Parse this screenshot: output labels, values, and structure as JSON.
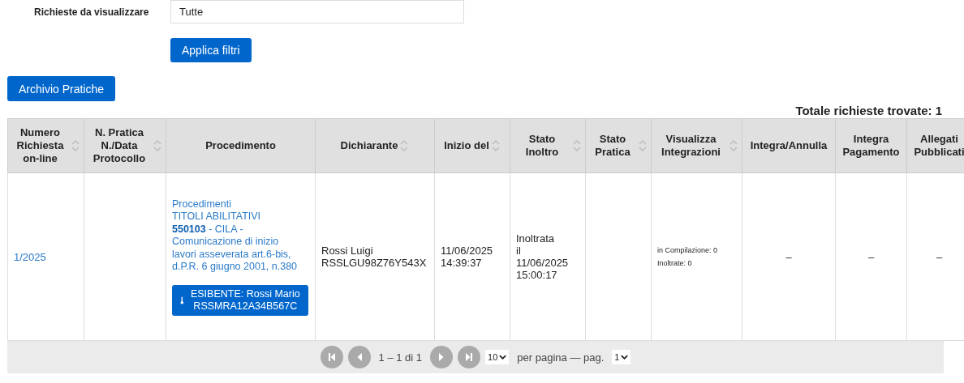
{
  "filter": {
    "label": "Richieste da visualizzare",
    "value": "Tutte",
    "apply_button": "Applica filtri"
  },
  "archive_button": "Archivio Pratiche",
  "total": "Totale richieste trovate: 1",
  "table": {
    "columns": [
      {
        "label": "Numero Richiesta on-line",
        "sortable": true
      },
      {
        "label": "N. Pratica N./Data Protocollo",
        "sortable": true
      },
      {
        "label": "Procedimento",
        "sortable": false
      },
      {
        "label": "Dichiarante",
        "sortable": true
      },
      {
        "label": "Inizio del",
        "sortable": true
      },
      {
        "label": "Stato Inoltro",
        "sortable": true
      },
      {
        "label": "Stato Pratica",
        "sortable": true
      },
      {
        "label": "Visualizza Integrazioni",
        "sortable": true
      },
      {
        "label": "Integra/Annulla",
        "sortable": false
      },
      {
        "label": "Integra Pagamento",
        "sortable": false
      },
      {
        "label": "Allegati Pubblicati",
        "sortable": false
      }
    ],
    "rows": [
      {
        "numero": "1/2025",
        "procedimento": {
          "category": "Procedimenti",
          "group": "TITOLI ABILITATIVI",
          "title": "**550103** - CILA - Comunicazione di inizio lavori asseverata art.6-bis, d.P.R. 6 giugno 2001, n.380"
        },
        "esibente_button": "ESIBENTE: Rossi Mario RSSMRA12A34B567C",
        "dichiarante": [
          "Rossi Luigi",
          "RSSLGU98Z76Y543X"
        ],
        "inizio": [
          "11/06/2025",
          "14:39:37"
        ],
        "stato_inoltro": [
          "Inoltrata",
          "il",
          "11/06/2025",
          "15:00:17"
        ],
        "integrazioni": [
          "in Compilazione: 0",
          "Inoltrate: 0"
        ],
        "integra_annulla": "–",
        "integra_pagamento": "–",
        "allegati": "–"
      }
    ]
  },
  "pagination": {
    "buttons": [
      {
        "kind": "first",
        "disabled": true
      },
      {
        "kind": "prev",
        "disabled": true
      }
    ],
    "range": "1 – 1 di 1",
    "next_buttons": [
      {
        "kind": "next",
        "disabled": true
      },
      {
        "kind": "last",
        "disabled": true
      }
    ],
    "per_page": "10",
    "per_page_label": "per pagina — pag.",
    "page": "1"
  }
}
